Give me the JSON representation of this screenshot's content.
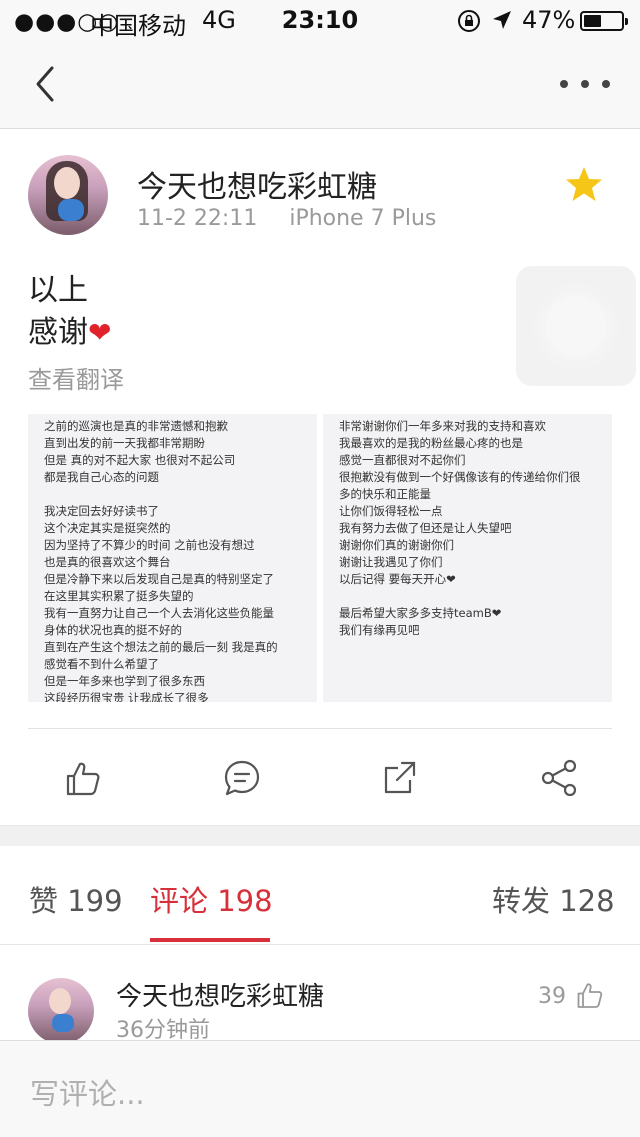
{
  "status_bar": {
    "signal": "●●●○○",
    "carrier": "中国移动",
    "network": "4G",
    "time": "23:10",
    "battery_percent": "47%",
    "battery_level": 0.47
  },
  "nav": {
    "back_icon": "chevron-left-icon",
    "more_icon": "more-dots-icon"
  },
  "post": {
    "author": "今天也想吃彩虹糖",
    "time": "11-2 22:11",
    "device": "iPhone 7 Plus",
    "text_line1": "以上",
    "text_line2": "感谢",
    "heart": "❤",
    "translate": "查看翻译",
    "favorite_icon": "star-icon",
    "star_color": "#f5c518",
    "images": {
      "left_lines": [
        "之前的巡演也是真的非常遗憾和抱歉",
        "直到出发的前一天我都非常期盼",
        "但是 真的对不起大家 也很对不起公司",
        "都是我自己心态的问题",
        "",
        "我决定回去好好读书了",
        "这个决定其实是挺突然的",
        "因为坚持了不算少的时间 之前也没有想过",
        "也是真的很喜欢这个舞台",
        "但是冷静下来以后发现自己是真的特别坚定了",
        "在这里其实积累了挺多失望的",
        "我有一直努力让自己一个人去消化这些负能量",
        "身体的状况也真的挺不好的",
        "直到在产生这个想法之前的最后一刻 我是真的",
        "感觉看不到什么希望了",
        "但是一年多来也学到了很多东西",
        "这段经历很宝贵 让我成长了很多"
      ],
      "right_lines": [
        "非常谢谢你们一年多来对我的支持和喜欢",
        "我最喜欢的是我的粉丝最心疼的也是",
        "感觉一直都很对不起你们",
        "很抱歉没有做到一个好偶像该有的传递给你们很",
        "多的快乐和正能量",
        "让你们饭得轻松一点",
        "我有努力去做了但还是让人失望吧",
        "谢谢你们真的谢谢你们",
        "谢谢让我遇见了你们",
        "以后记得 要每天开心❤",
        "",
        "最后希望大家多多支持teamB❤",
        "我们有缘再见吧"
      ]
    }
  },
  "actions": {
    "like_icon": "thumbs-up-icon",
    "comment_icon": "comment-icon",
    "forward_icon": "forward-icon",
    "share_icon": "share-icon"
  },
  "tabs": {
    "likes_label": "赞 199",
    "comments_label": "评论 198",
    "reposts_label": "转发 128",
    "active_color": "#d8303a"
  },
  "comments": [
    {
      "name": "今天也想吃彩虹糖",
      "time": "36分钟前",
      "likes": "39"
    }
  ],
  "compose": {
    "placeholder": "写评论..."
  }
}
